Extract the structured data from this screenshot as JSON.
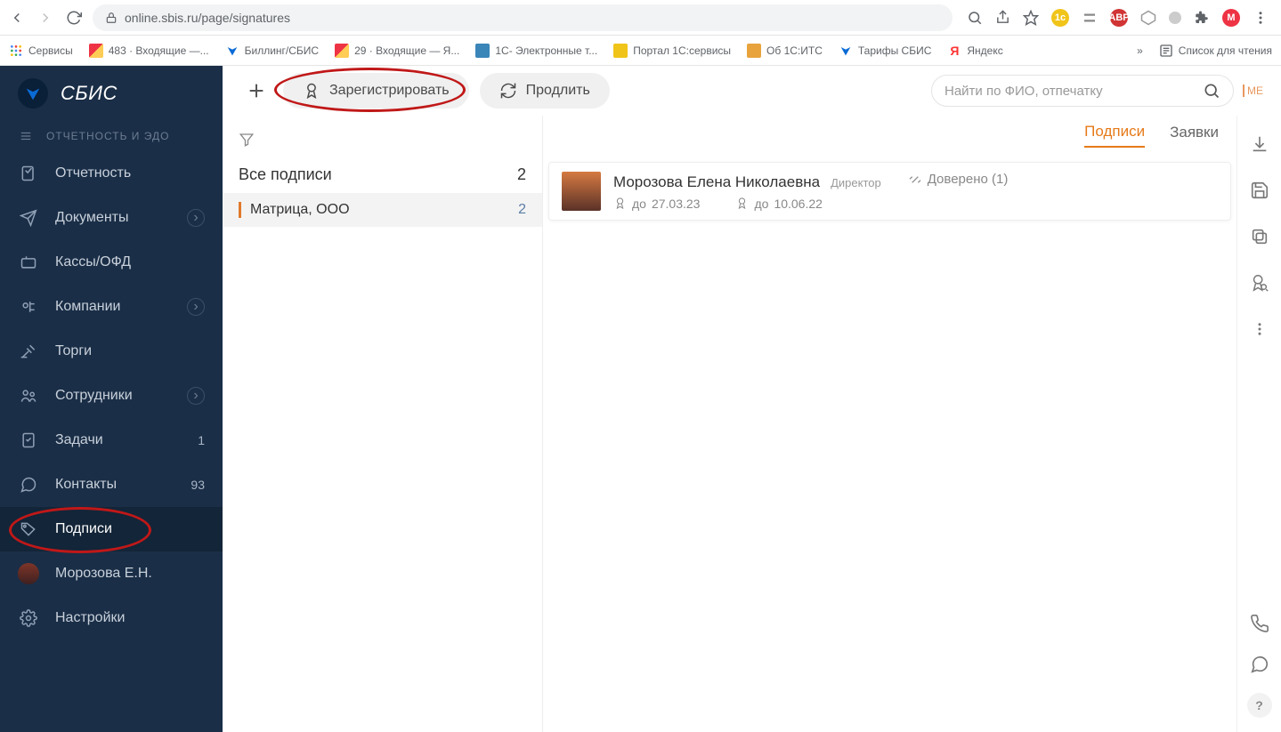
{
  "browser": {
    "url": "online.sbis.ru/page/signatures",
    "bookmarks": [
      {
        "label": "Сервисы",
        "color": ""
      },
      {
        "label": "483 · Входящие —...",
        "color": "#e34"
      },
      {
        "label": "Биллинг/СБИС",
        "color": "#0a6bd6"
      },
      {
        "label": "29 · Входящие — Я...",
        "color": "#e34"
      },
      {
        "label": "1С- Электронные т...",
        "color": "#3a86b8"
      },
      {
        "label": "Портал 1С:сервисы",
        "color": "#f0c419"
      },
      {
        "label": "Об 1С:ИТС",
        "color": "#e8a33d"
      },
      {
        "label": "Тарифы СБИС",
        "color": "#0a6bd6"
      },
      {
        "label": "Яндекс",
        "color": "#f33"
      }
    ],
    "reading_list": "Список для чтения"
  },
  "sidebar": {
    "brand": "СБИС",
    "section": "ОТЧЕТНОСТЬ И ЭДО",
    "items": [
      {
        "label": "Отчетность"
      },
      {
        "label": "Документы",
        "chev": true
      },
      {
        "label": "Кассы/ОФД"
      },
      {
        "label": "Компании",
        "chev": true
      },
      {
        "label": "Торги"
      },
      {
        "label": "Сотрудники",
        "chev": true
      },
      {
        "label": "Задачи",
        "badge": "1"
      },
      {
        "label": "Контакты",
        "badge": "93"
      },
      {
        "label": "Подписи",
        "active": true
      },
      {
        "label": "Морозова Е.Н.",
        "avatar": true
      },
      {
        "label": "Настройки"
      }
    ]
  },
  "topbar": {
    "register": "Зарегистрировать",
    "extend": "Продлить",
    "search_placeholder": "Найти по ФИО, отпечатку",
    "me": "МЕ"
  },
  "tabs": {
    "active": "Подписи",
    "other": "Заявки"
  },
  "list": {
    "heading": "Все подписи",
    "heading_count": "2",
    "items": [
      {
        "label": "Матрица, ООО",
        "count": "2"
      }
    ]
  },
  "card": {
    "name": "Морозова Елена Николаевна",
    "role": "Директор",
    "trusted": "Доверено (1)",
    "cert1_prefix": "до ",
    "cert1": "27.03.23",
    "cert2_prefix": "до ",
    "cert2": "10.06.22"
  }
}
